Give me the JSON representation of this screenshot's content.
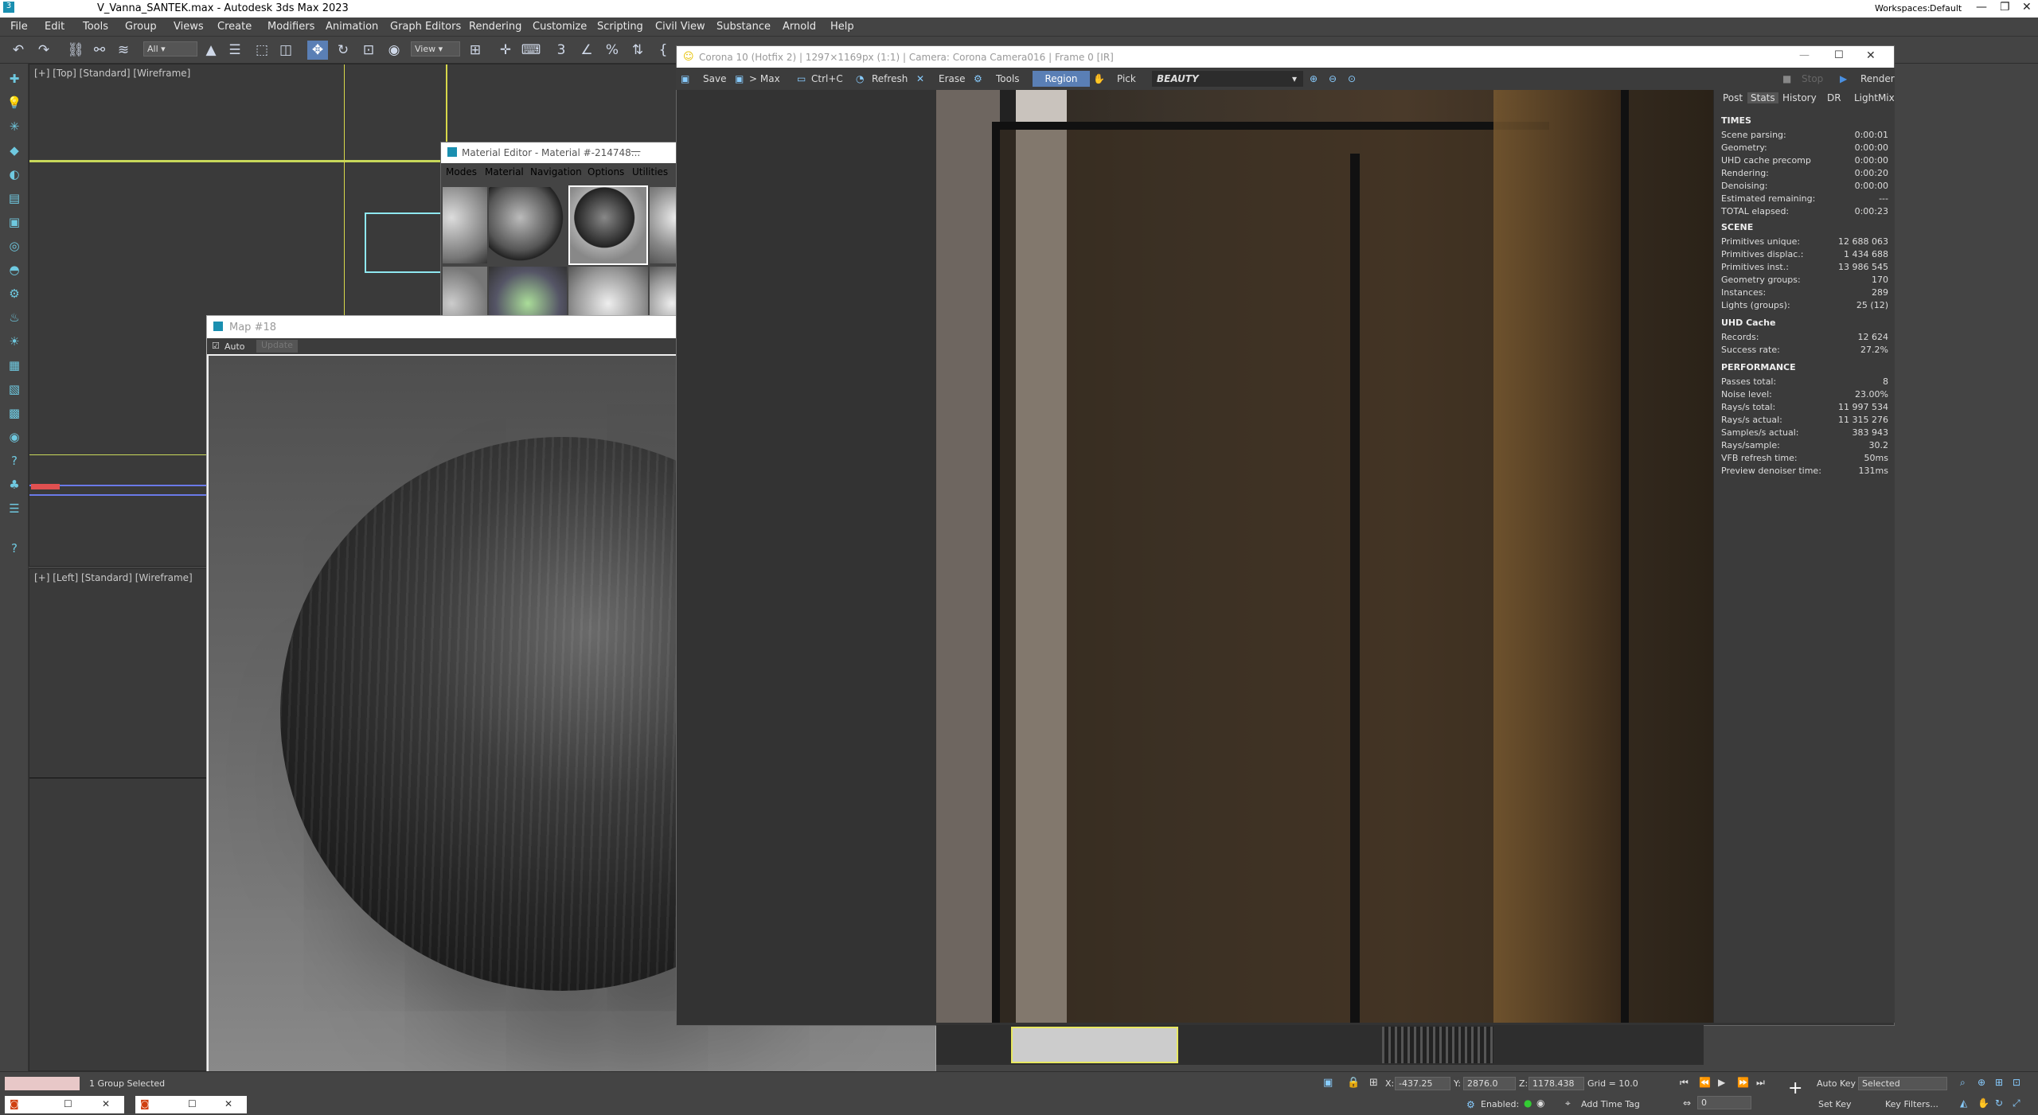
{
  "app": {
    "title": "V_Vanna_SANTEK.max - Autodesk 3ds Max 2023",
    "workspaces_label": "Workspaces:",
    "workspace": "Default"
  },
  "menu": [
    "File",
    "Edit",
    "Tools",
    "Group",
    "Views",
    "Create",
    "Modifiers",
    "Animation",
    "Graph Editors",
    "Rendering",
    "Customize",
    "Scripting",
    "Civil View",
    "Substance",
    "Arnold",
    "Help"
  ],
  "toolbar": {
    "filter": "All",
    "ref_coord": "View"
  },
  "viewports": {
    "top": "[+] [Top] [Standard] [Wireframe]",
    "left": "[+] [Left] [Standard] [Wireframe]"
  },
  "material_editor": {
    "title": "Material Editor - Material #-214748...",
    "menu": [
      "Modes",
      "Material",
      "Navigation",
      "Options",
      "Utilities"
    ]
  },
  "map_window": {
    "title": "Map #18",
    "auto_label": "Auto",
    "update_label": "Update"
  },
  "vfb": {
    "title": "Corona 10 (Hotfix 2) | 1297×1169px (1:1) | Camera: Corona Camera016 | Frame 0 [IR]",
    "buttons": {
      "save": "Save",
      "to_max": "> Max",
      "copy": "Ctrl+C",
      "refresh": "Refresh",
      "erase": "Erase",
      "tools": "Tools",
      "region": "Region",
      "pick": "Pick",
      "stop": "Stop",
      "render": "Render"
    },
    "channel": "BEAUTY",
    "tabs": [
      "Post",
      "Stats",
      "History",
      "DR",
      "LightMix"
    ],
    "stats": {
      "times_title": "TIMES",
      "times": [
        [
          "Scene parsing:",
          "0:00:01"
        ],
        [
          "Geometry:",
          "0:00:00"
        ],
        [
          "UHD cache precomp",
          "0:00:00"
        ],
        [
          "Rendering:",
          "0:00:20"
        ],
        [
          "Denoising:",
          "0:00:00"
        ],
        [
          "Estimated remaining:",
          "---"
        ],
        [
          "TOTAL elapsed:",
          "0:00:23"
        ]
      ],
      "scene_title": "SCENE",
      "scene": [
        [
          "Primitives unique:",
          "12 688 063"
        ],
        [
          "Primitives displac.:",
          "1 434 688"
        ],
        [
          "Primitives inst.:",
          "13 986 545"
        ],
        [
          "Geometry groups:",
          "170"
        ],
        [
          "Instances:",
          "289"
        ],
        [
          "Lights (groups):",
          "25 (12)"
        ]
      ],
      "uhd_title": "UHD Cache",
      "uhd": [
        [
          "Records:",
          "12 624"
        ],
        [
          "Success rate:",
          "27.2%"
        ]
      ],
      "perf_title": "PERFORMANCE",
      "perf": [
        [
          "Passes total:",
          "8"
        ],
        [
          "Noise level:",
          "23.00%"
        ],
        [
          "Rays/s total:",
          "11 997 534"
        ],
        [
          "Rays/s actual:",
          "11 315 276"
        ],
        [
          "Samples/s actual:",
          "383 943"
        ],
        [
          "Rays/sample:",
          "30.2"
        ],
        [
          "VFB refresh time:",
          "50ms"
        ],
        [
          "Preview denoiser time:",
          "131ms"
        ]
      ]
    }
  },
  "status": {
    "selection": "1 Group Selected",
    "x_label": "X:",
    "x": "-437.25",
    "y_label": "Y:",
    "y": "2876.0",
    "z_label": "Z:",
    "z": "1178.438",
    "grid": "Grid = 10.0",
    "enabled": "Enabled:",
    "add_time_tag": "Add Time Tag",
    "auto_key": "Auto Key",
    "set_key": "Set Key",
    "selected": "Selected",
    "key_filters": "Key Filters...",
    "frame": "0"
  },
  "colors": {
    "ui_bg": "#444444",
    "accent": "#5a7fb5",
    "viewport_bg": "#3a3a3a"
  }
}
